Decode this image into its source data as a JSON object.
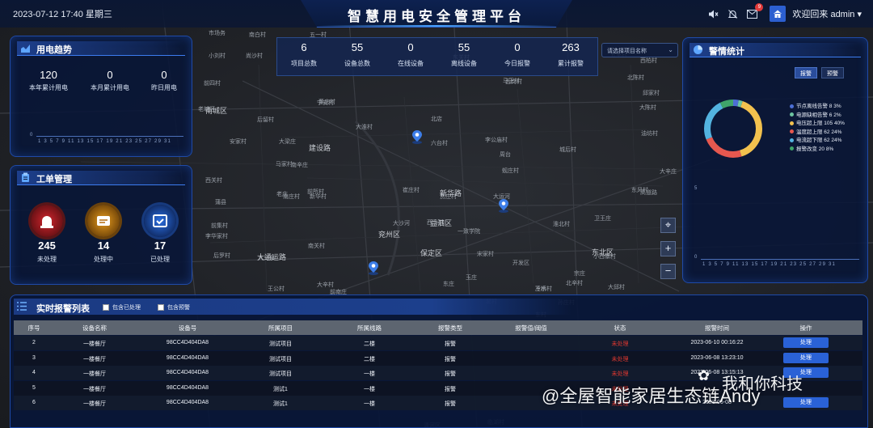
{
  "header": {
    "datetime": "2023-07-12 17:40 星期三",
    "title": "智慧用电安全管理平台",
    "notification_badge": "9",
    "welcome": "欢迎回来 admin"
  },
  "power_trend": {
    "title": "用电趋势",
    "stats": [
      {
        "value": "120",
        "label": "本年累计用电"
      },
      {
        "value": "0",
        "label": "本月累计用电"
      },
      {
        "value": "0",
        "label": "昨日用电"
      }
    ],
    "y_zero": "0",
    "x_ticks": "1 3 5 7 9 11 13 15 17 19 21 23 25 27 29 31"
  },
  "work_orders": {
    "title": "工单管理",
    "items": [
      {
        "value": "245",
        "label": "未处理",
        "color": "#c8242a"
      },
      {
        "value": "14",
        "label": "处理中",
        "color": "#d98a14"
      },
      {
        "value": "17",
        "label": "已处理",
        "color": "#1f5fd0"
      }
    ]
  },
  "summary": {
    "items": [
      {
        "value": "6",
        "label": "项目总数"
      },
      {
        "value": "55",
        "label": "设备总数"
      },
      {
        "value": "0",
        "label": "在线设备"
      },
      {
        "value": "55",
        "label": "离线设备"
      },
      {
        "value": "0",
        "label": "今日报警"
      },
      {
        "value": "263",
        "label": "累计报警"
      }
    ]
  },
  "project_select": {
    "placeholder": "请选择项目名称"
  },
  "map": {
    "controls": [
      "⌖",
      "+",
      "−"
    ],
    "labels": [
      "市场务",
      "南白村",
      "五一村",
      "小刘村",
      "尚沙村",
      "前四村",
      "东关村",
      "西岗村",
      "邱家村",
      "大陈村",
      "董庄村",
      "大淮村",
      "六台村",
      "李公庙村",
      "北店",
      "宁安村",
      "马家村",
      "安家村",
      "周台",
      "城后村",
      "油坊村",
      "大辛庄",
      "蚬庄村",
      "高道路",
      "淮北村",
      "西马村",
      "前所村",
      "新华村",
      "南关村",
      "前集村",
      "李华家村",
      "玉庄",
      "一致学院",
      "冷水",
      "大马泉",
      "王公村",
      "宋家村",
      "小西寨村",
      "东风村",
      "大辛村",
      "翟村",
      "东村",
      "大邱村",
      "北辛村",
      "前南庄",
      "东庄",
      "大运河",
      "老城区",
      "大梁庄",
      "卫王庄",
      "大沙河",
      "南辛庄",
      "蒲县",
      "后罗村",
      "南庄村",
      "崔庄村",
      "贾庄村",
      "马王村",
      "西柏村",
      "五里村",
      "老庄",
      "清河区",
      "西关村",
      "临湖村",
      "孙庄村",
      "后留村",
      "北陈村",
      "王桥村",
      "宗庄",
      "开发区"
    ],
    "districts": [
      "兖州区",
      "益泗区",
      "保定区",
      "大通运路",
      "东北区",
      "建设路",
      "新华路",
      "南城区"
    ]
  },
  "alarm_stats": {
    "title": "警情统计",
    "toggle": [
      "报警",
      "预警"
    ],
    "legend": [
      {
        "label": "节点离线告警 8  3%",
        "color": "#4c6fd6"
      },
      {
        "label": "电源缺相告警 6  2%",
        "color": "#6cc4a0"
      },
      {
        "label": "电压超上限 105  40%",
        "color": "#f2c14e"
      },
      {
        "label": "温度超上限 62  24%",
        "color": "#e6584f"
      },
      {
        "label": "电流超下限 62  24%",
        "color": "#53b3e0"
      },
      {
        "label": "报警改变 20  8%",
        "color": "#3fa56a"
      }
    ],
    "chart_data": {
      "type": "pie",
      "categories": [
        "节点离线告警",
        "电源缺相告警",
        "电压超上限",
        "温度超上限",
        "电流超下限",
        "报警改变"
      ],
      "values": [
        8,
        6,
        105,
        62,
        62,
        20
      ]
    },
    "y_top": "5",
    "y_zero": "0",
    "x_ticks": "1 3 5 7 9 11 13 15 17 19 21 23 25 27 29 31"
  },
  "alarm_table": {
    "title": "实时报警列表",
    "filters": [
      "包含已处理",
      "包含预警"
    ],
    "columns": [
      "序号",
      "设备名称",
      "设备号",
      "所属项目",
      "所属线路",
      "报警类型",
      "报警值/阈值",
      "状态",
      "报警时间",
      "操作"
    ],
    "rows": [
      {
        "no": "2",
        "name": "一楼餐厅",
        "device": "98CC4D404DA8",
        "project": "测试项目",
        "line": "二楼",
        "type": "报警",
        "value": "",
        "status": "未处理",
        "time": "2023-06-10 00:16:22",
        "op": "处理"
      },
      {
        "no": "3",
        "name": "一楼餐厅",
        "device": "98CC4D404DA8",
        "project": "测试项目",
        "line": "二楼",
        "type": "报警",
        "value": "",
        "status": "未处理",
        "time": "2023-06-08 13:23:10",
        "op": "处理"
      },
      {
        "no": "4",
        "name": "一楼餐厅",
        "device": "98CC4D404DA8",
        "project": "测试项目",
        "line": "一楼",
        "type": "报警",
        "value": "",
        "status": "未处理",
        "time": "2023-06-08 13:15:13",
        "op": "处理"
      },
      {
        "no": "5",
        "name": "一楼餐厅",
        "device": "98CC4D404DA8",
        "project": "测试1",
        "line": "一楼",
        "type": "报警",
        "value": "",
        "status": "未处理",
        "time": "",
        "op": ""
      },
      {
        "no": "6",
        "name": "一楼餐厅",
        "device": "98CC4D404DA8",
        "project": "测试1",
        "line": "一楼",
        "type": "报警",
        "value": "",
        "status": "未处理",
        "time": "2023-06-08",
        "op": "处理"
      }
    ]
  },
  "watermark": "@全屋智能家居生态链Andy",
  "watermark2": "我和你科技"
}
